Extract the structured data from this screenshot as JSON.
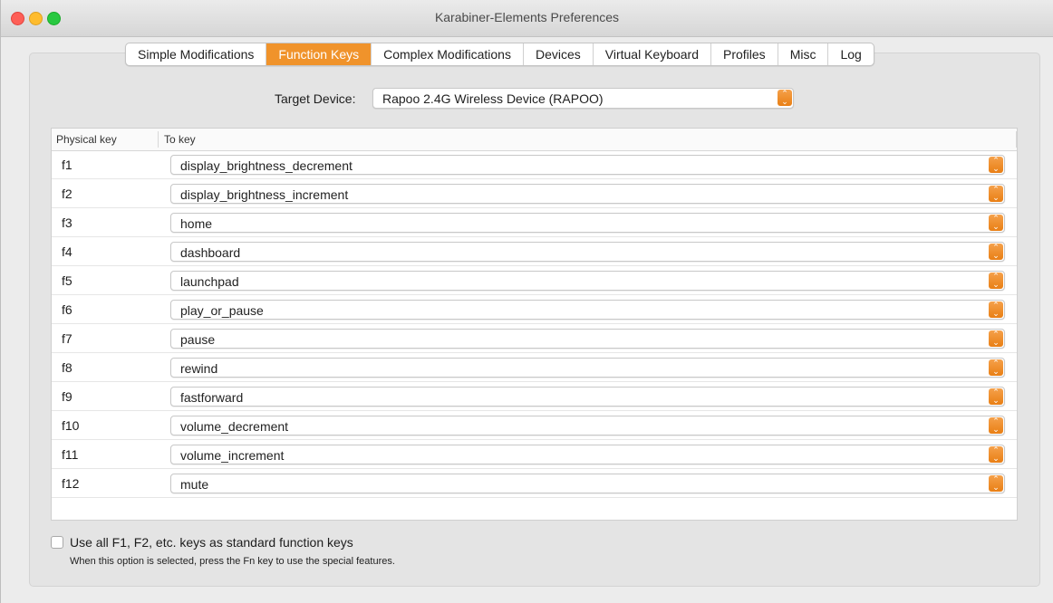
{
  "window": {
    "title": "Karabiner-Elements Preferences"
  },
  "tabs": [
    {
      "label": "Simple Modifications",
      "active": false
    },
    {
      "label": "Function Keys",
      "active": true
    },
    {
      "label": "Complex Modifications",
      "active": false
    },
    {
      "label": "Devices",
      "active": false
    },
    {
      "label": "Virtual Keyboard",
      "active": false
    },
    {
      "label": "Profiles",
      "active": false
    },
    {
      "label": "Misc",
      "active": false
    },
    {
      "label": "Log",
      "active": false
    }
  ],
  "target_device": {
    "label": "Target Device:",
    "value": "Rapoo 2.4G Wireless Device (RAPOO)"
  },
  "table": {
    "headers": {
      "physical": "Physical key",
      "to": "To key"
    },
    "rows": [
      {
        "key": "f1",
        "to": "display_brightness_decrement"
      },
      {
        "key": "f2",
        "to": "display_brightness_increment"
      },
      {
        "key": "f3",
        "to": "home"
      },
      {
        "key": "f4",
        "to": "dashboard"
      },
      {
        "key": "f5",
        "to": "launchpad"
      },
      {
        "key": "f6",
        "to": "play_or_pause"
      },
      {
        "key": "f7",
        "to": "pause"
      },
      {
        "key": "f8",
        "to": "rewind"
      },
      {
        "key": "f9",
        "to": "fastforward"
      },
      {
        "key": "f10",
        "to": "volume_decrement"
      },
      {
        "key": "f11",
        "to": "volume_increment"
      },
      {
        "key": "f12",
        "to": "mute"
      }
    ]
  },
  "option": {
    "checked": false,
    "label": "Use all F1, F2, etc. keys as standard function keys",
    "note": "When this option is selected, press the Fn key to use the special features."
  },
  "colors": {
    "accent": "#f0932b"
  },
  "icons": {
    "stepper": "up-down-chevron-icon"
  }
}
